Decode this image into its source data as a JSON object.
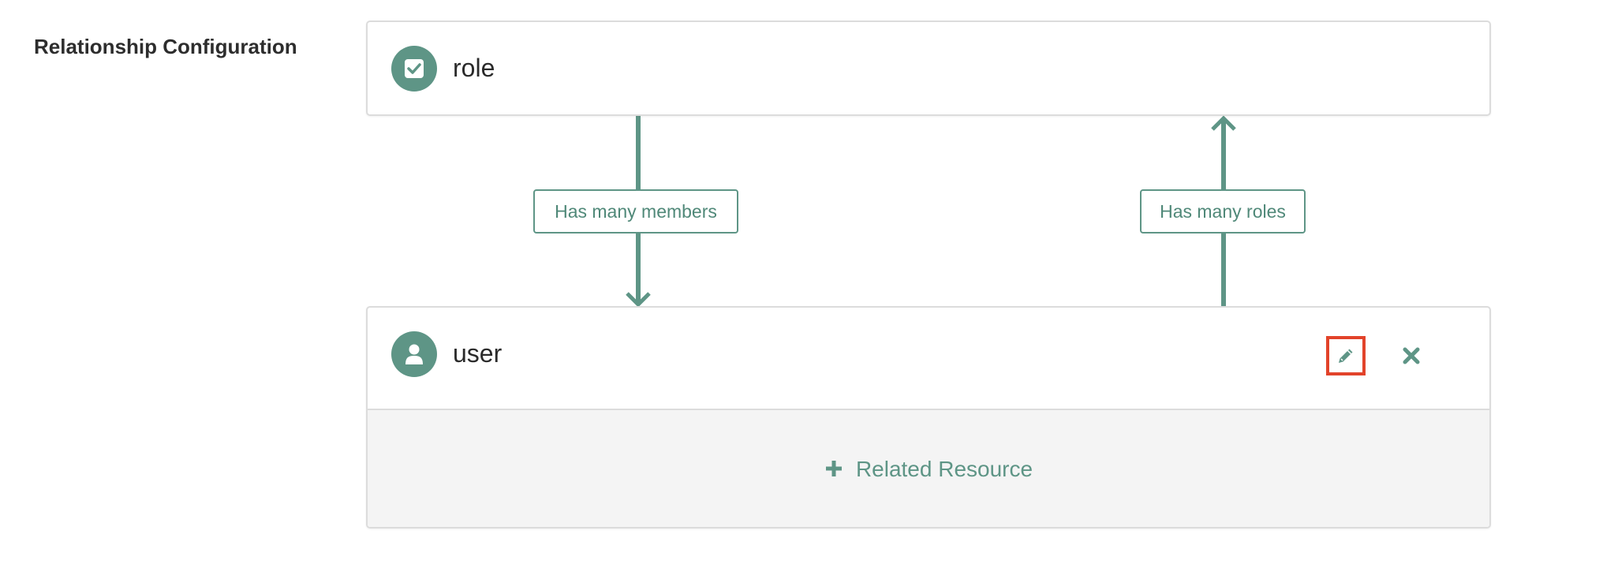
{
  "section": {
    "label": "Relationship Configuration"
  },
  "role_card": {
    "title": "role",
    "icon": "checkbox-icon"
  },
  "user_card": {
    "title": "user",
    "icon": "user-icon",
    "edit_icon": "pencil-icon",
    "delete_icon": "close-icon",
    "add_related_label": "Related Resource",
    "add_icon": "plus-icon"
  },
  "relationships": {
    "members_label": "Has many members",
    "roles_label": "Has many roles"
  },
  "colors": {
    "accent": "#5e9586",
    "highlight": "#e2432a",
    "border": "#dcdcdc",
    "footer_bg": "#f4f4f4"
  }
}
